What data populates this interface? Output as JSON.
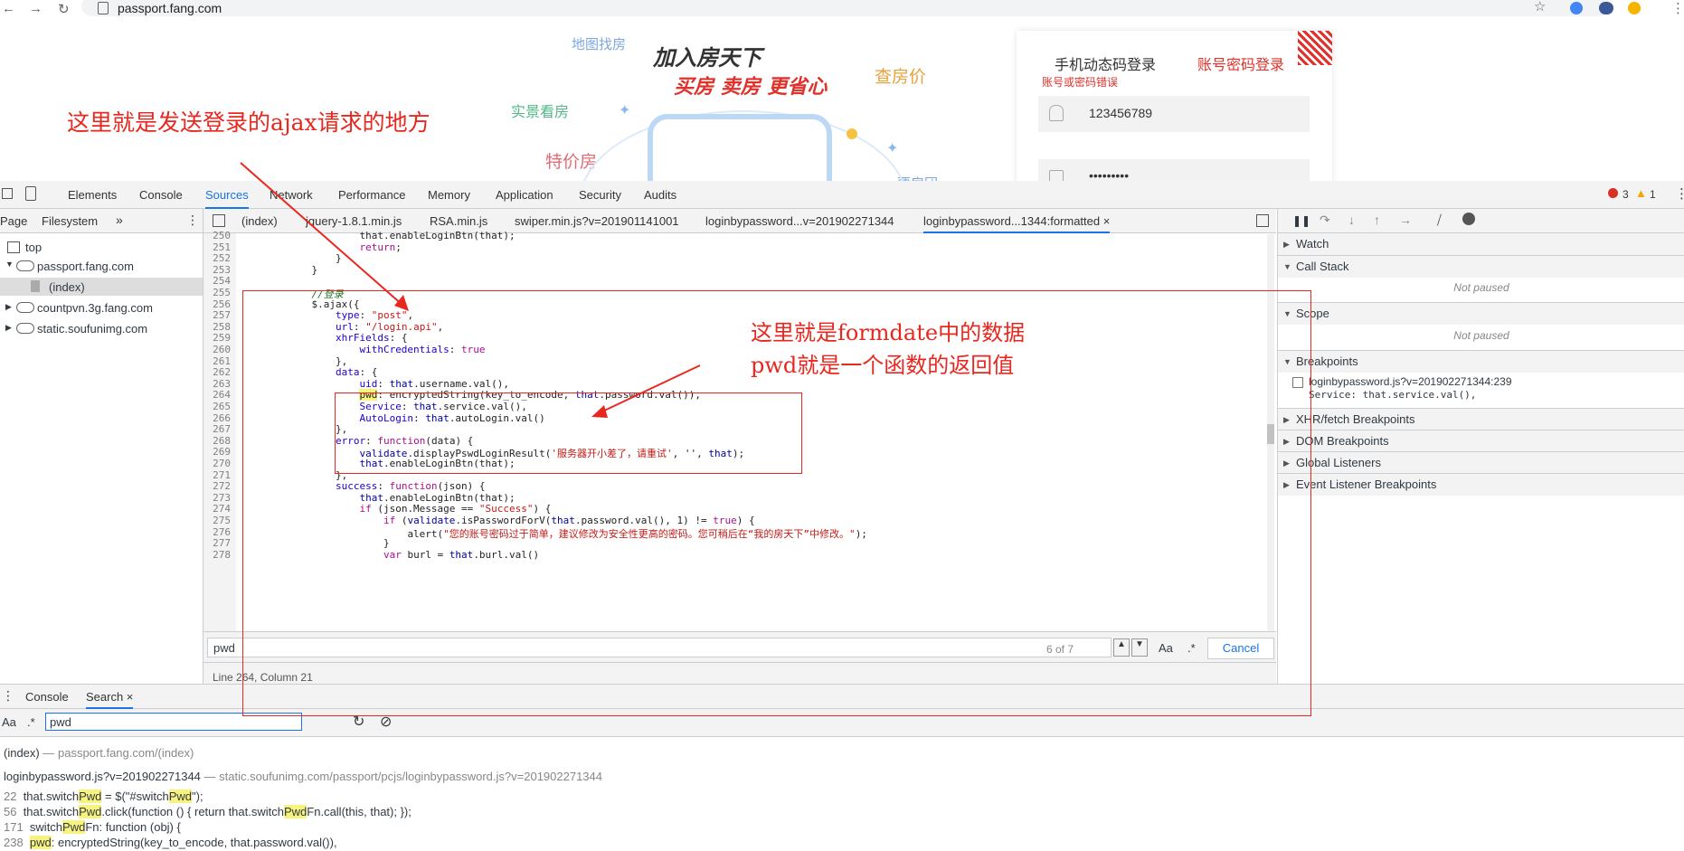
{
  "browser": {
    "url": "passport.fang.com",
    "back": "←",
    "forward": "→",
    "reload": "↻",
    "star": "☆"
  },
  "page": {
    "promo": {
      "map_search": "地图找房",
      "join_title": "加入房天下",
      "buy_sell": "买房 卖房 更省心",
      "check_price": "查房价",
      "real_view": "实景看房",
      "special": "特价房",
      "right_label": "要房团"
    },
    "login": {
      "tab_sms": "手机动态码登录",
      "tab_password": "账号密码登录",
      "error": "账号或密码错误",
      "username": "123456789",
      "password": "•••••••••"
    }
  },
  "devtools": {
    "tabs": [
      "Elements",
      "Console",
      "Sources",
      "Network",
      "Performance",
      "Memory",
      "Application",
      "Security",
      "Audits"
    ],
    "errors": "3",
    "warnings": "1",
    "navigator": {
      "tabs": [
        "Page",
        "Filesystem",
        "»"
      ],
      "tree": [
        "top",
        "passport.fang.com",
        "(index)",
        "countpvn.3g.fang.com",
        "static.soufunimg.com"
      ]
    },
    "file_tabs": [
      "(index)",
      "jquery-1.8.1.min.js",
      "RSA.min.js",
      "swiper.min.js?v=201901141001",
      "loginbypassword...v=201902271344",
      "loginbypassword...1344:formatted ×"
    ],
    "line_numbers": [
      "250",
      "251",
      "252",
      "253",
      "254",
      "255",
      "256",
      "257",
      "258",
      "259",
      "260",
      "261",
      "262",
      "263",
      "264",
      "265",
      "266",
      "267",
      "268",
      "269",
      "270",
      "271",
      "272",
      "273",
      "274",
      "275",
      "276",
      "277",
      "278"
    ],
    "find": {
      "query": "pwd",
      "count": "6 of 7",
      "match_case": "Aa",
      "regex": ".*",
      "cancel": "Cancel"
    },
    "status": "Line 264, Column 21",
    "debugger": {
      "sections": [
        "Watch",
        "Call Stack",
        "Scope",
        "Breakpoints",
        "XHR/fetch Breakpoints",
        "DOM Breakpoints",
        "Global Listeners",
        "Event Listener Breakpoints"
      ],
      "not_paused": "Not paused",
      "breakpoint_file": "loginbypassword.js?v=201902271344:239",
      "breakpoint_code": "Service: that.service.val(),"
    },
    "drawer": {
      "tabs": [
        "Console",
        "Search ×"
      ],
      "search_query": "pwd",
      "aa": "Aa",
      "regex": ".*",
      "results": {
        "file1": "(index)",
        "file1_path": "— passport.fang.com/(index)",
        "file2": "loginbypassword.js?v=201902271344",
        "file2_path": "— static.soufunimg.com/passport/pcjs/loginbypassword.js?v=201902271344",
        "lines": [
          {
            "no": "22",
            "text": "that.switchPwd = $(\"#switchPwd\");"
          },
          {
            "no": "56",
            "text": "that.switchPwd.click(function () { return that.switchPwdFn.call(this, that); });"
          },
          {
            "no": "171",
            "text": "switchPwdFn: function (obj) {"
          },
          {
            "no": "238",
            "text": "pwd: encryptedString(key_to_encode, that.password.val()),"
          }
        ]
      }
    }
  },
  "annotations": {
    "top": "这里就是发送登录的ajax请求的地方",
    "right_line1": "这里就是formdate中的数据",
    "right_line2": "pwd就是一个函数的返回值"
  },
  "colors": {
    "annotation": "#e8271f",
    "accent": "#1a73e8",
    "highlight": "#f8f37e"
  }
}
